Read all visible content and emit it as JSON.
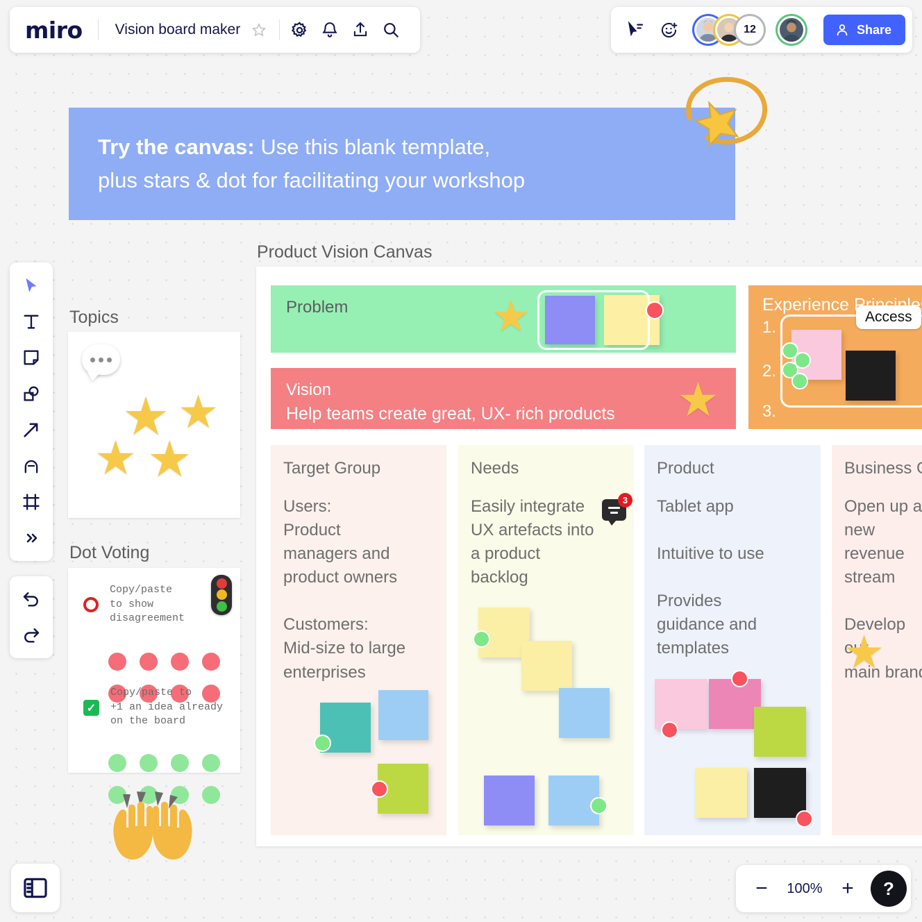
{
  "app": {
    "logo": "miro",
    "board_title": "Vision board maker"
  },
  "topbar_left": {
    "icons": [
      "star-outline-icon",
      "gear-icon",
      "bell-icon",
      "upload-icon",
      "search-icon"
    ]
  },
  "topbar_right": {
    "cursor_label_icon": "cursor-tag-icon",
    "reaction_icon": "emoji-add-icon",
    "overflow_count": "12",
    "share_label": "Share",
    "share_icon": "person-icon"
  },
  "left_toolbar": {
    "tools": [
      {
        "name": "select-tool",
        "icon": "cursor-icon"
      },
      {
        "name": "text-tool",
        "icon": "text-icon"
      },
      {
        "name": "sticky-note-tool",
        "icon": "sticky-note-icon"
      },
      {
        "name": "shapes-tool",
        "icon": "shapes-icon"
      },
      {
        "name": "connector-tool",
        "icon": "arrow-icon"
      },
      {
        "name": "pen-tool",
        "icon": "pen-icon"
      },
      {
        "name": "frame-tool",
        "icon": "frame-icon"
      },
      {
        "name": "more-tools",
        "icon": "chevron-double-right-icon"
      }
    ],
    "history": [
      {
        "name": "undo-button",
        "icon": "undo-icon"
      },
      {
        "name": "redo-button",
        "icon": "redo-icon"
      }
    ]
  },
  "banner": {
    "bold_lead": "Try the canvas:",
    "line1_rest": " Use this blank template,",
    "line2": "plus stars & dot for facilitating your workshop",
    "bg_color": "#8fadf5"
  },
  "topics": {
    "label": "Topics",
    "stars_count": 4
  },
  "dot_voting": {
    "label": "Dot Voting",
    "item1_text": "Copy/paste\nto show\ndisagreement",
    "item2_text": "Copy/paste to\n+1 an idea already\non the board",
    "red_dots": 8,
    "green_dots": 8,
    "red_color": "#f66d77",
    "green_color": "#90e79a"
  },
  "canvas": {
    "label": "Product Vision Canvas",
    "problem": {
      "title": "Problem",
      "bg_color": "#96f0b4"
    },
    "vision": {
      "title": "Vision",
      "body": "Help teams create great, UX- rich products",
      "bg_color": "#f48083"
    },
    "experience": {
      "title": "Experience Principles",
      "items": [
        "1.",
        "2.",
        "3."
      ],
      "chip_label": "Access",
      "bg_color": "#f5ab5c"
    },
    "columns": [
      {
        "name": "target-group",
        "title": "Target Group",
        "body": "Users:\nProduct\nmanagers and\nproduct owners\n\nCustomers:\nMid-size to large\nenterprises",
        "bg_color": "#fcf1ec"
      },
      {
        "name": "needs",
        "title": "Needs",
        "body": "Easily integrate\nUX artefacts into\na product\nbacklog",
        "comment_count": "3",
        "bg_color": "#fafbe8"
      },
      {
        "name": "product",
        "title": "Product",
        "body": "Tablet app\n\nIntuitive to use\n\nProvides\nguidance and\ntemplates",
        "bg_color": "#eef2fb"
      },
      {
        "name": "business-goals",
        "title": "Business Goals",
        "body": "Open up a new\nrevenue stream\n\nDevelop our\nmain brand",
        "bg_color": "#fdeeec"
      }
    ]
  },
  "bottom": {
    "panel_toggle_icon": "sidebar-panel-icon",
    "zoom_out_label": "−",
    "zoom_value": "100%",
    "zoom_in_label": "+",
    "help_label": "?"
  }
}
